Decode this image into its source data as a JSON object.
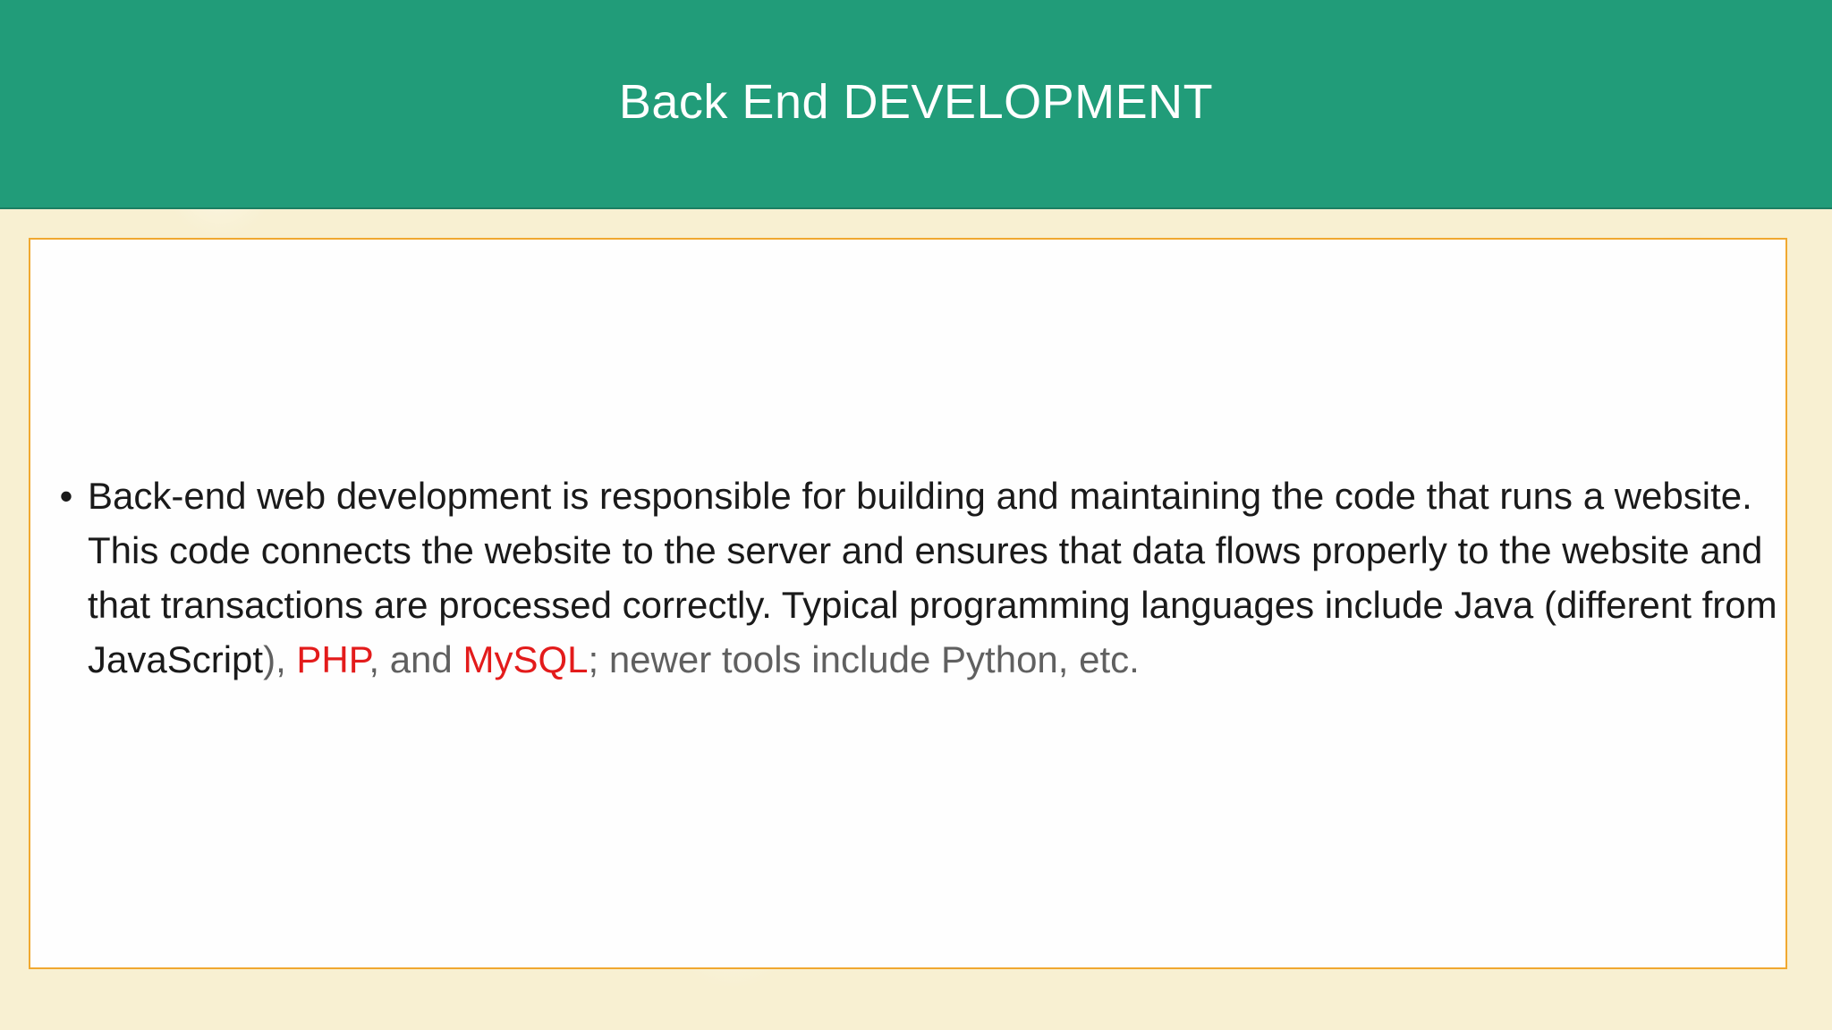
{
  "slide": {
    "title": "Back End DEVELOPMENT",
    "bullet_symbol": "•",
    "bullet": {
      "seg1": "Back-end web development is responsible for building and maintaining the code that runs a website. This code connects the website to the server and ensures that data flows properly to the website and that transactions are processed correctly. Typical programming languages include Java (different from JavaScript",
      "seg2": "), ",
      "seg3": "PHP",
      "seg4": ", and ",
      "seg5": "MySQL",
      "seg6": "; newer tools include Python, etc."
    }
  },
  "colors": {
    "title_bar": "#219c79",
    "background": "#f8f0d2",
    "box_border": "#f0a830",
    "highlight_red": "#e31b1b",
    "muted_gray": "#606060"
  }
}
